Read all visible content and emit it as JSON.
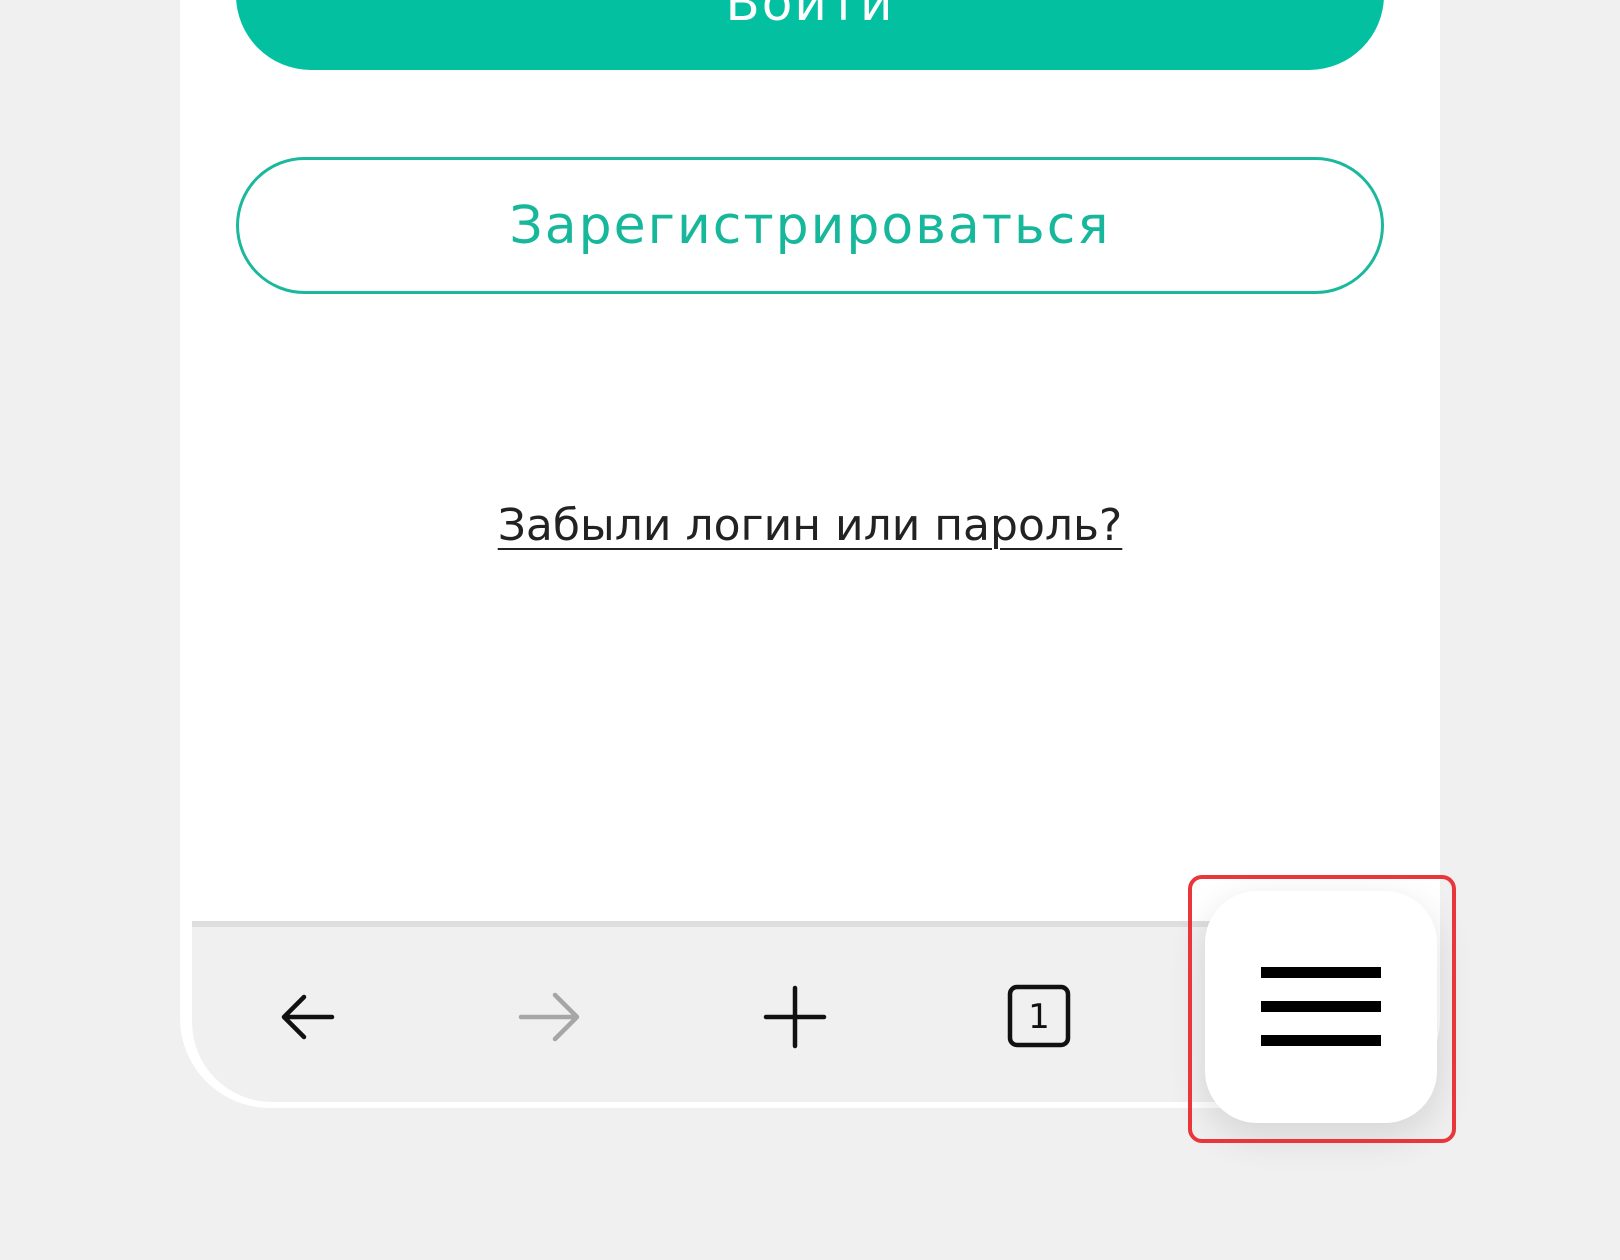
{
  "page": {
    "login_label": "Войти",
    "register_label": "Зарегистрироваться",
    "forgot_label": "Забыли логин или пароль?"
  },
  "toolbar": {
    "back_icon": "arrow-left-icon",
    "forward_icon": "arrow-right-icon",
    "new_tab_icon": "plus-icon",
    "tabs_icon": "tabs-icon",
    "tabs_count": "1",
    "menu_icon": "hamburger-menu-icon"
  },
  "colors": {
    "accent": "#03c1a0",
    "accent_border": "#1bb89d",
    "highlight": "#e8363a",
    "background": "#f0f0f0"
  }
}
